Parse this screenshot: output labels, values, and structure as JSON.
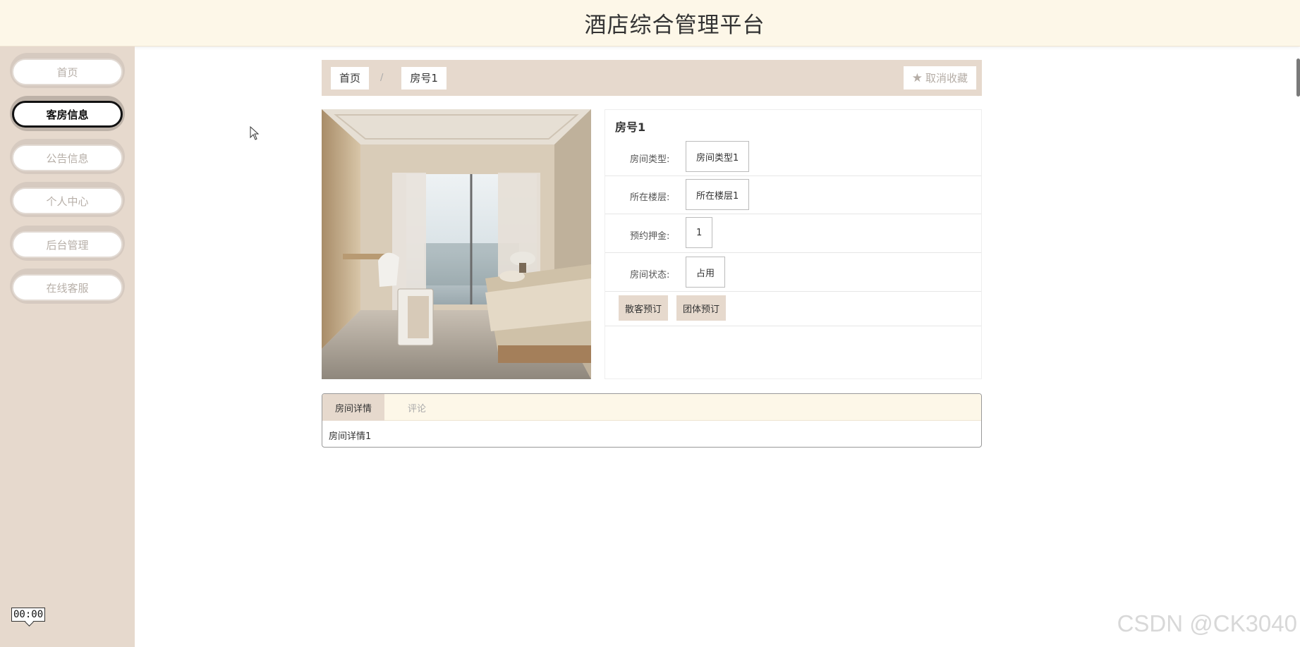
{
  "header": {
    "title": "酒店综合管理平台"
  },
  "sidebar": {
    "items": [
      {
        "label": "首页"
      },
      {
        "label": "客房信息"
      },
      {
        "label": "公告信息"
      },
      {
        "label": "个人中心"
      },
      {
        "label": "后台管理"
      },
      {
        "label": "在线客服"
      }
    ],
    "active_index": 1,
    "timer": "00:00"
  },
  "breadcrumb": {
    "home": "首页",
    "separator": "/",
    "current": "房号1"
  },
  "favorite": {
    "label": "取消收藏"
  },
  "room": {
    "title": "房号1",
    "fields": [
      {
        "label": "房间类型:",
        "value": "房间类型1"
      },
      {
        "label": "所在楼层:",
        "value": "所在楼层1"
      },
      {
        "label": "预约押金:",
        "value": "1"
      },
      {
        "label": "房间状态:",
        "value": "占用"
      }
    ],
    "actions": [
      {
        "label": "散客预订"
      },
      {
        "label": "团体预订"
      }
    ]
  },
  "tabs": {
    "items": [
      {
        "label": "房间详情"
      },
      {
        "label": "评论"
      }
    ],
    "active_index": 0,
    "content": "房间详情1"
  },
  "watermark": "CSDN @CK3040",
  "colors": {
    "accent": "#e6d9cd",
    "header_bg": "#fdf7e8"
  }
}
